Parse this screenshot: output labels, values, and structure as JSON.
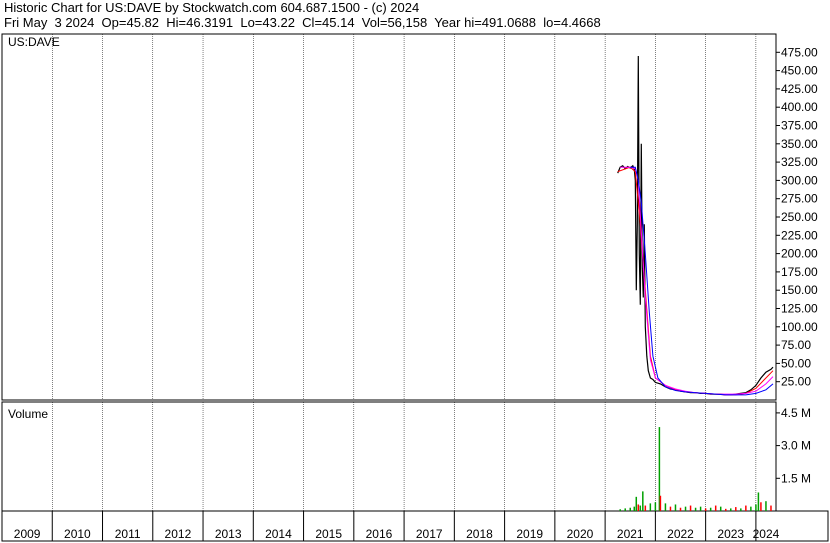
{
  "header": {
    "title": "Historic Chart for US:DAVE by Stockwatch.com 604.687.1500 - (c) 2024",
    "date": "Fri May  3 2024",
    "stats": [
      {
        "label": "Op",
        "value": "45.82"
      },
      {
        "label": "Hi",
        "value": "46.3191"
      },
      {
        "label": "Lo",
        "value": "43.22"
      },
      {
        "label": "Cl",
        "value": "45.14"
      },
      {
        "label": "Vol",
        "value": "56,158"
      },
      {
        "label": "Year hi",
        "value": "491.0688"
      },
      {
        "label": "lo",
        "value": "4.4668"
      }
    ]
  },
  "colors": {
    "price": "#000000",
    "ma_red": "#ff0000",
    "ma_blue": "#0000ff",
    "ma_magenta": "#ff00ff",
    "volume_up": "#00a000",
    "volume_down": "#ff0000",
    "grid": "#000000",
    "background": "#ffffff"
  },
  "chart_data": [
    {
      "type": "line",
      "title": "US:DAVE",
      "ylim": [
        0,
        500
      ],
      "yticks": [
        25,
        50,
        75,
        100,
        125,
        150,
        175,
        200,
        225,
        250,
        275,
        300,
        325,
        350,
        375,
        400,
        425,
        450,
        475
      ],
      "ytick_labels": [
        "25.00",
        "50.00",
        "75.00",
        "100.00",
        "125.00",
        "150.00",
        "175.00",
        "200.00",
        "225.00",
        "250.00",
        "275.00",
        "300.00",
        "325.00",
        "350.00",
        "375.00",
        "400.00",
        "425.00",
        "450.00",
        "475.00"
      ],
      "x_tick_labels": [
        "2009",
        "2010",
        "2011",
        "2012",
        "2013",
        "2014",
        "2015",
        "2016",
        "2017",
        "2018",
        "2019",
        "2020",
        "2021",
        "2022",
        "2023",
        "2024"
      ],
      "x_range": [
        2009.0,
        2024.4
      ],
      "grid": true,
      "series": [
        {
          "key": "close",
          "x": [
            2021.25,
            2021.3,
            2021.35,
            2021.4,
            2021.45,
            2021.5,
            2021.55,
            2021.58,
            2021.6,
            2021.62,
            2021.64,
            2021.66,
            2021.68,
            2021.7,
            2021.72,
            2021.74,
            2021.76,
            2021.78,
            2021.8,
            2021.83,
            2021.86,
            2021.9,
            2021.95,
            2022.0,
            2022.1,
            2022.2,
            2022.3,
            2022.4,
            2022.5,
            2022.6,
            2022.7,
            2022.8,
            2022.9,
            2023.0,
            2023.1,
            2023.2,
            2023.3,
            2023.4,
            2023.5,
            2023.6,
            2023.7,
            2023.8,
            2023.9,
            2024.0,
            2024.1,
            2024.2,
            2024.3,
            2024.34
          ],
          "y": [
            310,
            318,
            320,
            316,
            319,
            317,
            320,
            315,
            300,
            150,
            240,
            470,
            200,
            130,
            350,
            180,
            140,
            240,
            100,
            60,
            40,
            30,
            28,
            24,
            22,
            18,
            15,
            14,
            12,
            11,
            10,
            10,
            9,
            9,
            8,
            8,
            8,
            7,
            7,
            8,
            9,
            10,
            14,
            20,
            30,
            38,
            42,
            45
          ]
        },
        {
          "key": "ma_red",
          "x": [
            2021.25,
            2021.5,
            2021.6,
            2021.7,
            2021.8,
            2021.9,
            2022.0,
            2022.2,
            2022.4,
            2022.6,
            2022.8,
            2023.0,
            2023.2,
            2023.4,
            2023.6,
            2023.8,
            2024.0,
            2024.2,
            2024.34
          ],
          "y": [
            312,
            318,
            312,
            240,
            150,
            60,
            30,
            20,
            14,
            11,
            10,
            9,
            8,
            7,
            7,
            9,
            16,
            30,
            40
          ]
        },
        {
          "key": "ma_magenta",
          "x": [
            2021.3,
            2021.5,
            2021.6,
            2021.66,
            2021.72,
            2021.8,
            2021.9,
            2022.0,
            2022.2,
            2022.4,
            2022.6,
            2022.8,
            2023.0,
            2023.2,
            2023.4,
            2023.6,
            2023.8,
            2024.0,
            2024.2,
            2024.34
          ],
          "y": [
            318,
            318,
            316,
            300,
            230,
            140,
            55,
            30,
            20,
            15,
            12,
            10,
            9,
            8,
            8,
            8,
            9,
            12,
            22,
            32
          ]
        },
        {
          "key": "ma_blue",
          "x": [
            2021.5,
            2021.6,
            2021.66,
            2021.72,
            2021.8,
            2021.88,
            2021.95,
            2022.05,
            2022.2,
            2022.4,
            2022.6,
            2022.8,
            2023.0,
            2023.2,
            2023.4,
            2023.6,
            2023.8,
            2024.0,
            2024.2,
            2024.34
          ],
          "y": [
            318,
            318,
            300,
            270,
            200,
            120,
            60,
            30,
            18,
            13,
            11,
            10,
            9,
            8,
            7,
            7,
            7,
            9,
            14,
            22
          ]
        }
      ]
    },
    {
      "type": "bar",
      "title": "Volume",
      "ylim": [
        0,
        5000000
      ],
      "yticks": [
        1500000,
        3000000,
        4500000
      ],
      "ytick_labels": [
        "1.5 M",
        "3.0 M",
        "4.5 M"
      ],
      "x_range": [
        2009.0,
        2024.4
      ],
      "series": [
        {
          "key": "volume",
          "x": [
            2021.3,
            2021.4,
            2021.5,
            2021.58,
            2021.62,
            2021.66,
            2021.7,
            2021.75,
            2021.8,
            2021.9,
            2022.0,
            2022.08,
            2022.1,
            2022.2,
            2022.3,
            2022.4,
            2022.5,
            2022.6,
            2022.7,
            2022.8,
            2022.9,
            2023.0,
            2023.1,
            2023.2,
            2023.3,
            2023.4,
            2023.5,
            2023.6,
            2023.7,
            2023.8,
            2023.9,
            2024.0,
            2024.05,
            2024.1,
            2024.2,
            2024.3
          ],
          "y": [
            80000,
            120000,
            150000,
            200000,
            650000,
            300000,
            250000,
            900000,
            250000,
            350000,
            400000,
            3850000,
            700000,
            350000,
            200000,
            300000,
            150000,
            200000,
            250000,
            150000,
            200000,
            120000,
            150000,
            250000,
            200000,
            100000,
            120000,
            180000,
            120000,
            250000,
            200000,
            300000,
            850000,
            400000,
            450000,
            250000
          ],
          "direction": [
            "up",
            "up",
            "up",
            "up",
            "up",
            "down",
            "up",
            "up",
            "down",
            "up",
            "up",
            "up",
            "down",
            "up",
            "down",
            "up",
            "down",
            "up",
            "down",
            "up",
            "up",
            "down",
            "up",
            "down",
            "up",
            "down",
            "up",
            "down",
            "up",
            "down",
            "up",
            "up",
            "up",
            "down",
            "up",
            "down"
          ]
        }
      ]
    }
  ]
}
